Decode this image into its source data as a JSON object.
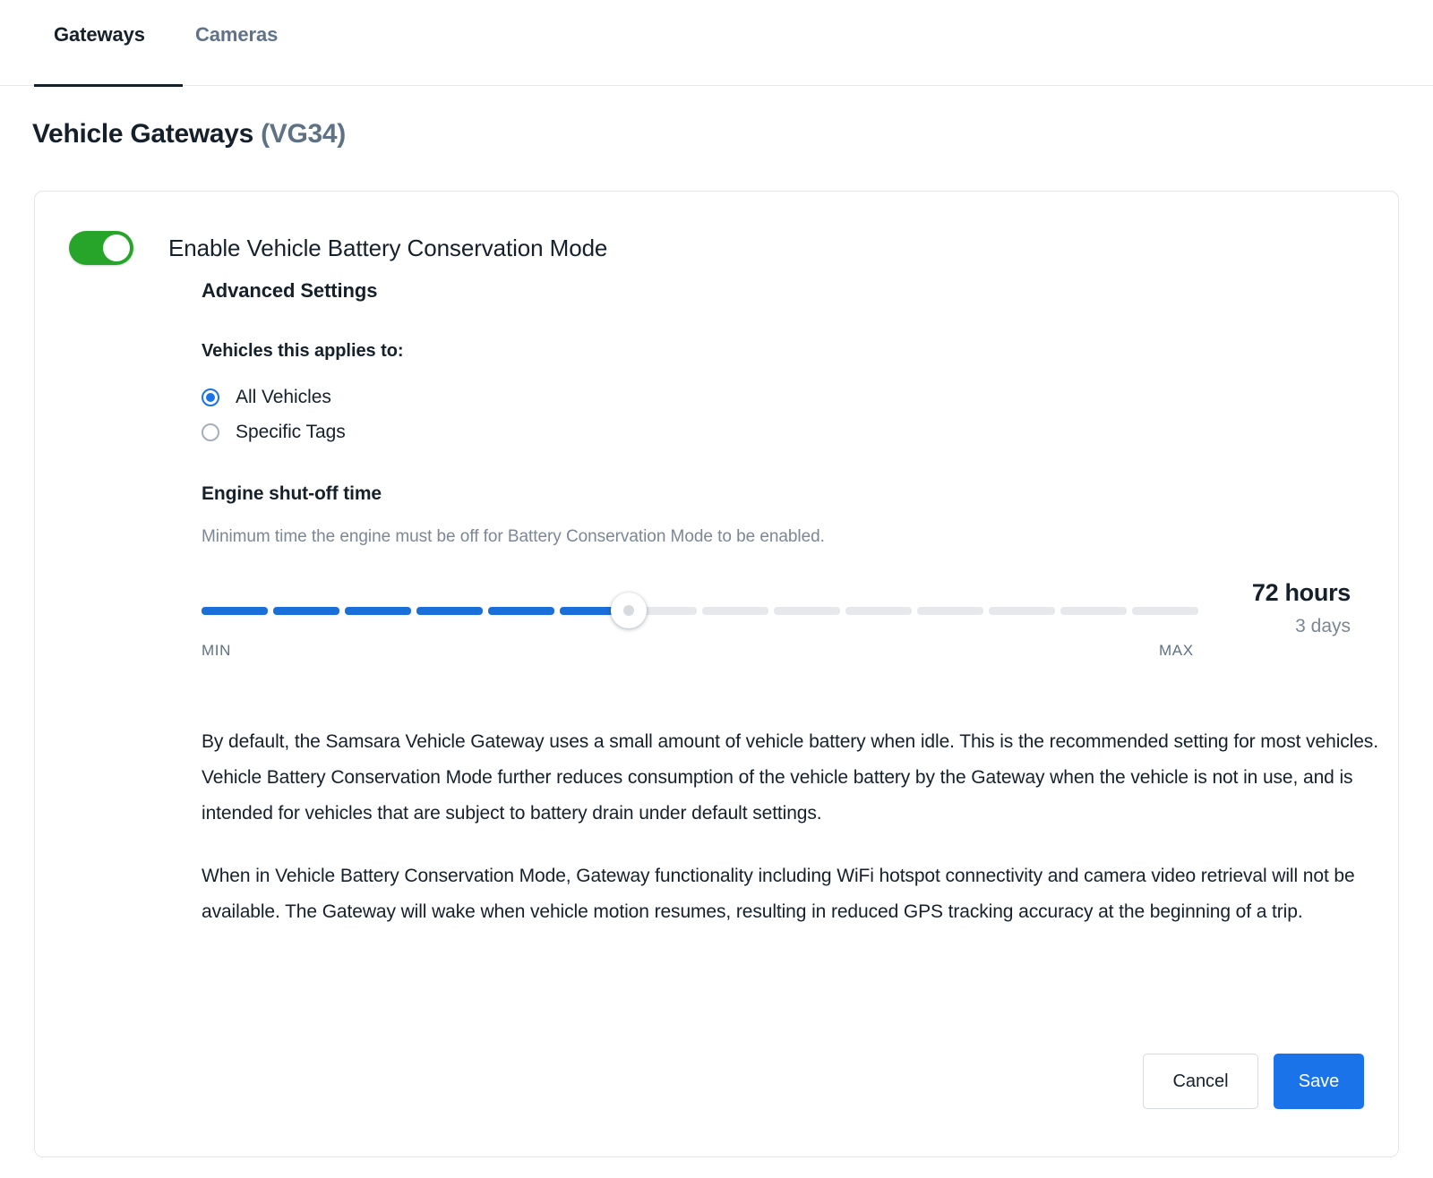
{
  "tabs": [
    {
      "label": "Gateways",
      "active": true
    },
    {
      "label": "Cameras",
      "active": false
    }
  ],
  "page": {
    "title": "Vehicle Gateways",
    "model": "(VG34)"
  },
  "settings": {
    "toggle": {
      "label": "Enable Vehicle Battery Conservation Mode",
      "state": "on",
      "on_color": "#27a52a"
    },
    "advanced_heading": "Advanced Settings",
    "applies_to_label": "Vehicles this applies to:",
    "radios": [
      {
        "label": "All Vehicles",
        "selected": true
      },
      {
        "label": "Specific Tags",
        "selected": false
      }
    ],
    "slider": {
      "title": "Engine shut-off time",
      "description": "Minimum time the engine must be off for Battery Conservation Mode to be enabled.",
      "min_label": "MIN",
      "max_label": "MAX",
      "value_primary": "72 hours",
      "value_secondary": "3 days",
      "segments_total": 14,
      "segments_filled": 6,
      "fill_color": "#1a6fd8",
      "track_color": "#e6e8ec"
    },
    "paragraphs": [
      "By default, the Samsara Vehicle Gateway uses a small amount of vehicle battery when idle. This is the recommended setting for most vehicles. Vehicle Battery Conservation Mode further reduces consumption of the vehicle battery by the Gateway when the vehicle is not in use, and is intended for vehicles that are subject to battery drain under default settings.",
      "When in Vehicle Battery Conservation Mode, Gateway functionality including WiFi hotspot connectivity and camera video retrieval will not be available. The Gateway will wake when vehicle motion resumes, resulting in reduced GPS tracking accuracy at the beginning of a trip."
    ]
  },
  "footer": {
    "cancel_label": "Cancel",
    "save_label": "Save",
    "save_color": "#1a73e8"
  }
}
